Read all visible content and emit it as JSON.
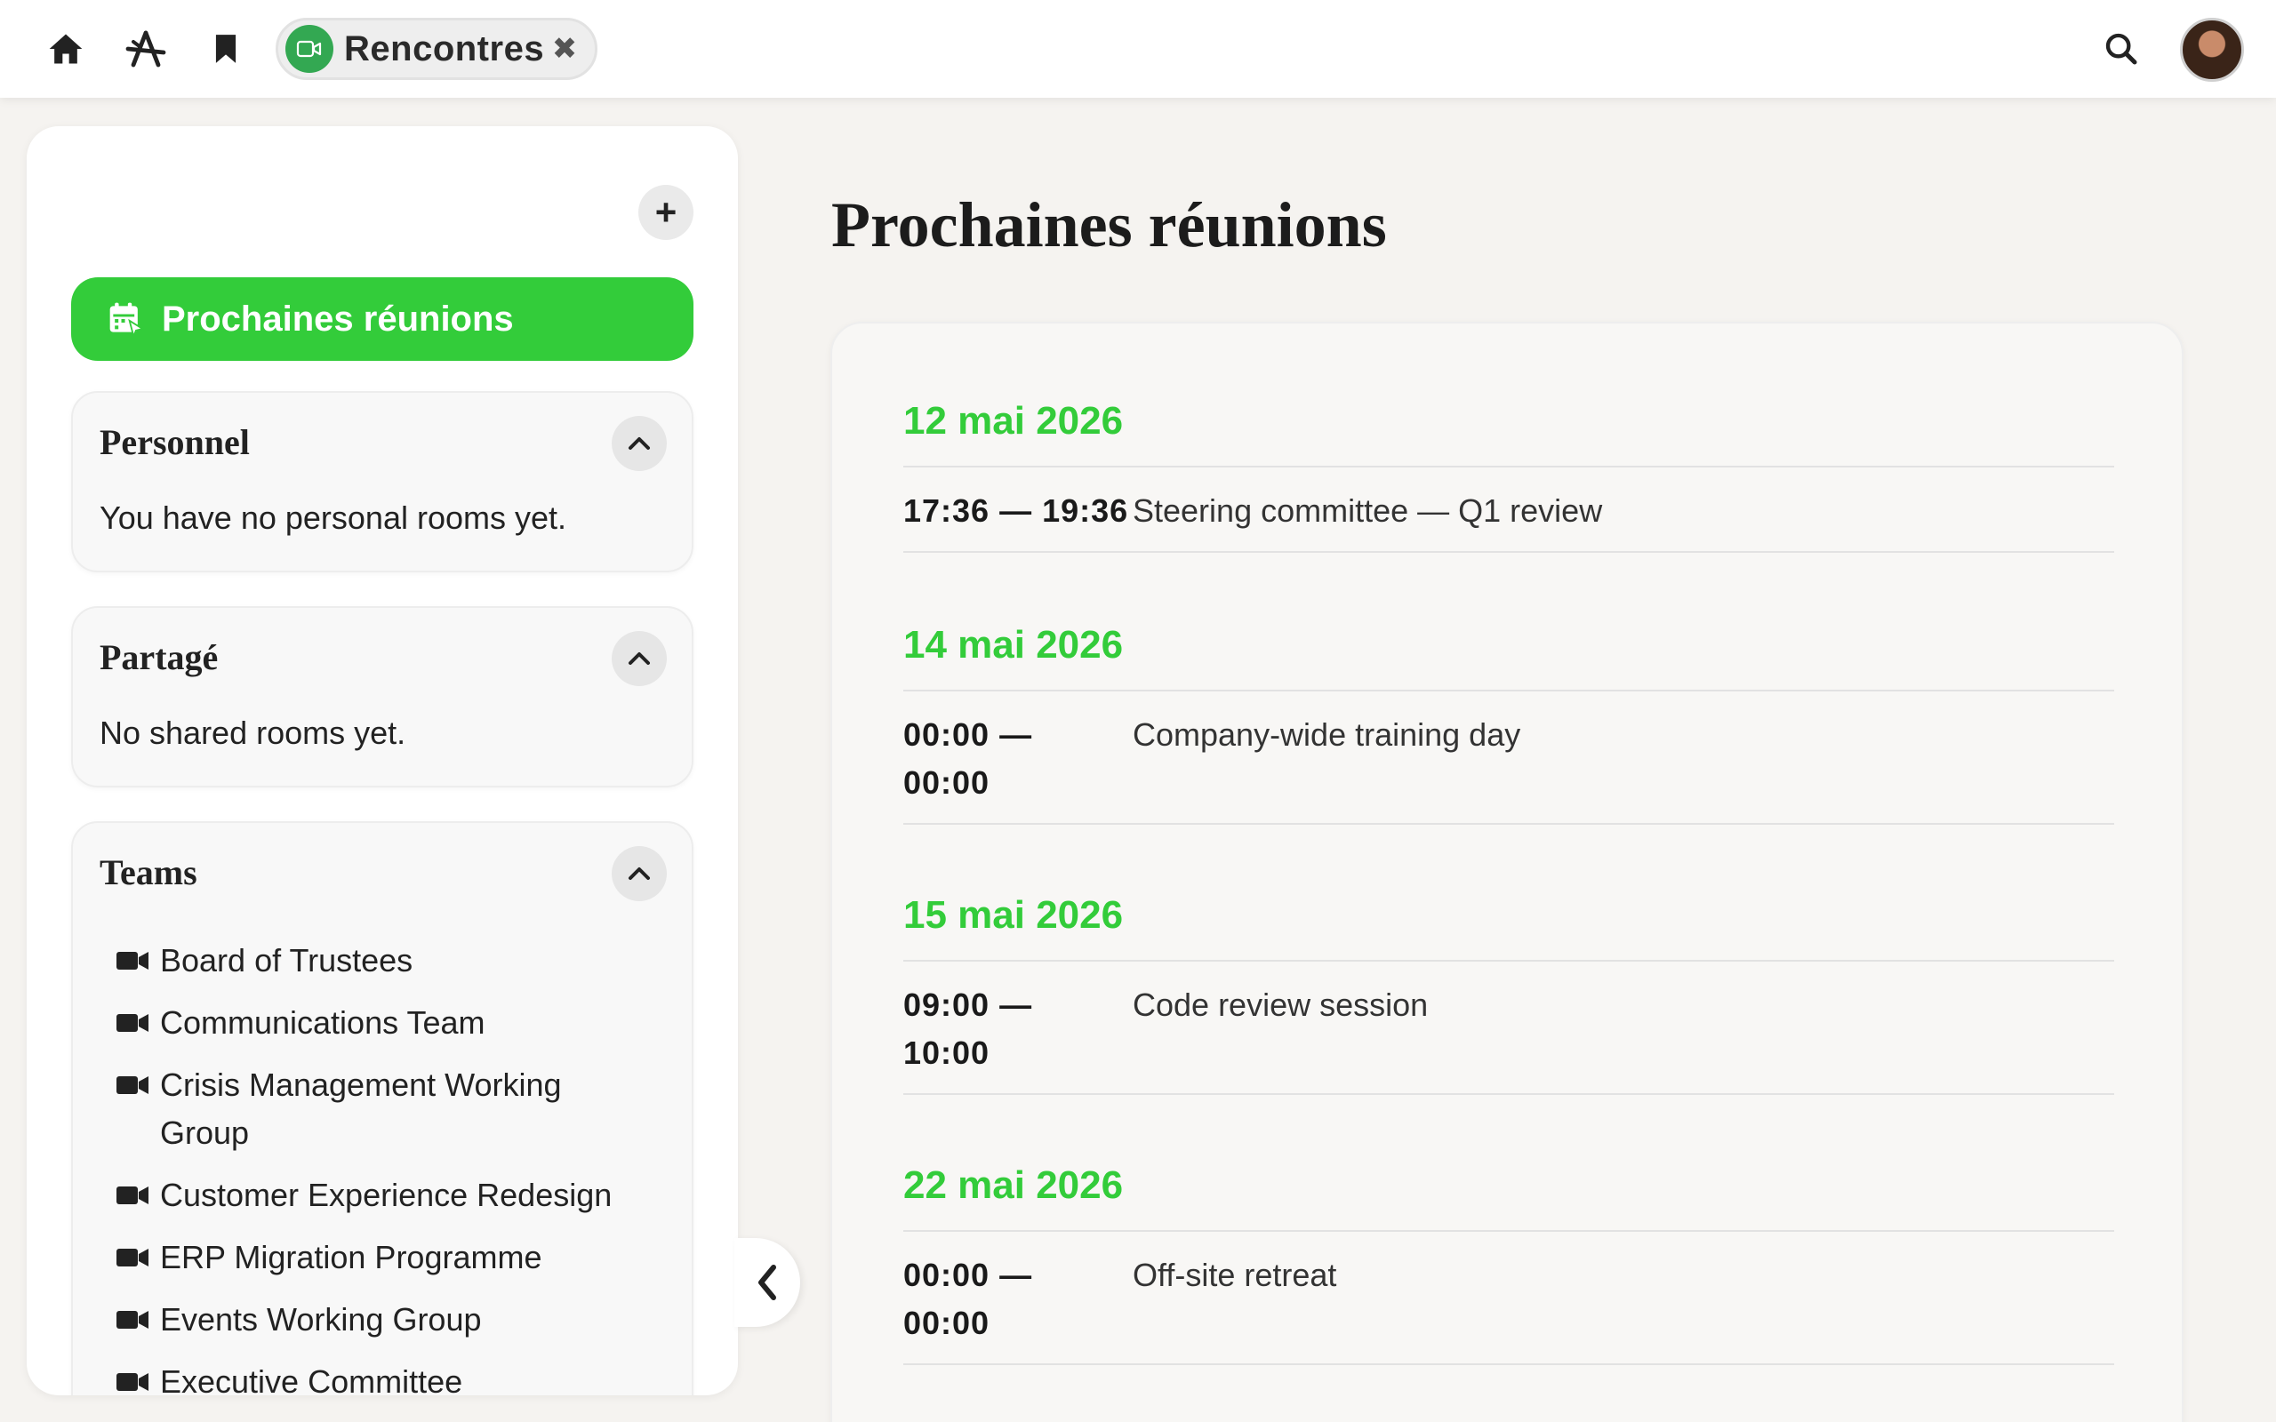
{
  "topbar": {
    "app_name": "Rencontres",
    "close_symbol": "✖",
    "icons": [
      "home-icon",
      "apps-icon",
      "bookmark-icon",
      "video-icon",
      "search-icon"
    ]
  },
  "sidebar": {
    "add_symbol": "+",
    "upcoming_label": "Prochaines réunions",
    "personal": {
      "title": "Personnel",
      "empty_text": "You have no personal rooms yet."
    },
    "shared": {
      "title": "Partagé",
      "empty_text": "No shared rooms yet."
    },
    "teams": {
      "title": "Teams",
      "items": [
        "Board of Trustees",
        "Communications Team",
        "Crisis Management Working Group",
        "Customer Experience Redesign",
        "ERP Migration Programme",
        "Events Working Group",
        "Executive Committee"
      ]
    }
  },
  "main": {
    "page_title": "Prochaines réunions",
    "days": [
      {
        "date": "12 mai 2026",
        "events": [
          {
            "time": "17:36 — 19:36",
            "title": "Steering committee — Q1 review"
          }
        ]
      },
      {
        "date": "14 mai 2026",
        "events": [
          {
            "time": "00:00 — 00:00",
            "title": "Company-wide training day"
          }
        ]
      },
      {
        "date": "15 mai 2026",
        "events": [
          {
            "time": "09:00 — 10:00",
            "title": "Code review session"
          }
        ]
      },
      {
        "date": "22 mai 2026",
        "events": [
          {
            "time": "00:00 — 00:00",
            "title": "Off-site retreat"
          }
        ]
      }
    ]
  },
  "colors": {
    "accent": "#33cc3a",
    "app_badge": "#33a852",
    "background": "#f5f3f0"
  }
}
